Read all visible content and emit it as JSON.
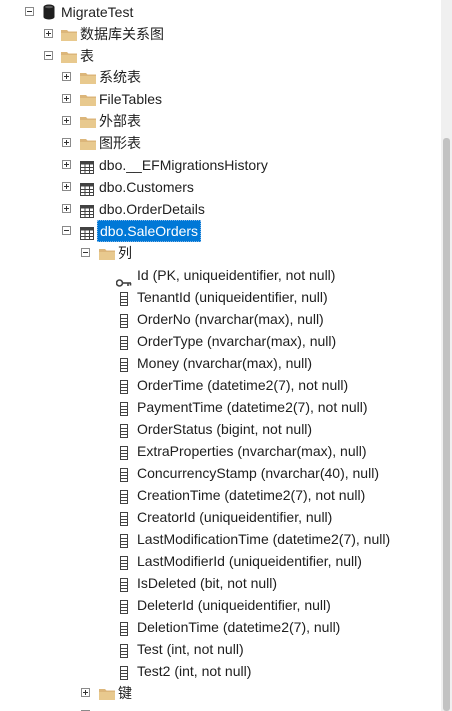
{
  "tree": {
    "db_label": "MigrateTest",
    "diagrams_label": "数据库关系图",
    "tables_label": "表",
    "system_tables_label": "系统表",
    "filetables_label": "FileTables",
    "external_tables_label": "外部表",
    "graph_tables_label": "图形表",
    "table_ef_history": "dbo.__EFMigrationsHistory",
    "table_customers": "dbo.Customers",
    "table_orderdetails": "dbo.OrderDetails",
    "table_saleorders": "dbo.SaleOrders",
    "columns_label": "列",
    "keys_label": "键",
    "columns": [
      "Id (PK, uniqueidentifier, not null)",
      "TenantId (uniqueidentifier, null)",
      "OrderNo (nvarchar(max), null)",
      "OrderType (nvarchar(max), null)",
      "Money (nvarchar(max), null)",
      "OrderTime (datetime2(7), not null)",
      "PaymentTime (datetime2(7), not null)",
      "OrderStatus (bigint, not null)",
      "ExtraProperties (nvarchar(max), null)",
      "ConcurrencyStamp (nvarchar(40), null)",
      "CreationTime (datetime2(7), not null)",
      "CreatorId (uniqueidentifier, null)",
      "LastModificationTime (datetime2(7), null)",
      "LastModifierId (uniqueidentifier, null)",
      "IsDeleted (bit, not null)",
      "DeleterId (uniqueidentifier, null)",
      "DeletionTime (datetime2(7), null)",
      "Test (int, not null)",
      "Test2 (int, not null)"
    ]
  },
  "colors": {
    "selection": "#0078d7",
    "folder": "#dcb67a",
    "icon": "#424242"
  }
}
